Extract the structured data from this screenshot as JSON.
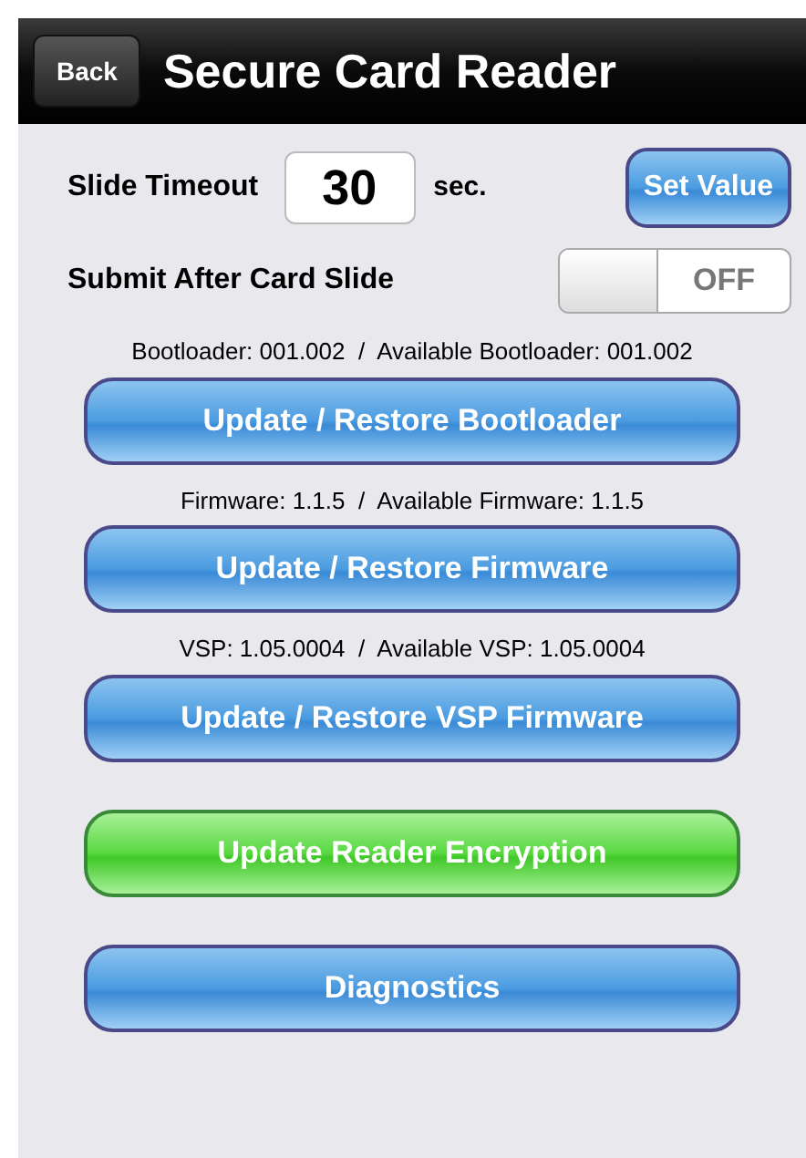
{
  "nav_bar": {
    "back": "Back",
    "title": "Secure Card Reader"
  },
  "timeout": {
    "label": "Slide Timeout",
    "value": "30",
    "unit": "sec.",
    "button": "Set Value"
  },
  "submit_after_slide": {
    "label": "Submit After Card Slide",
    "on": false,
    "state_text": "OFF"
  },
  "sections": [
    {
      "info": "Bootloader: 001.002  /  Available Bootloader: 001.002",
      "button": "Update / Restore Bootloader",
      "kind": "blue"
    },
    {
      "info": "Firmware: 1.1.5  /  Available Firmware: 1.1.5",
      "button": "Update / Restore Firmware",
      "kind": "blue"
    },
    {
      "info": "VSP: 1.05.0004  /  Available VSP: 1.05.0004",
      "button": "Update / Restore VSP Firmware",
      "kind": "blue"
    },
    {
      "button": "Update Reader Encryption",
      "kind": "green"
    },
    {
      "button": "Diagnostics",
      "kind": "blue"
    }
  ]
}
